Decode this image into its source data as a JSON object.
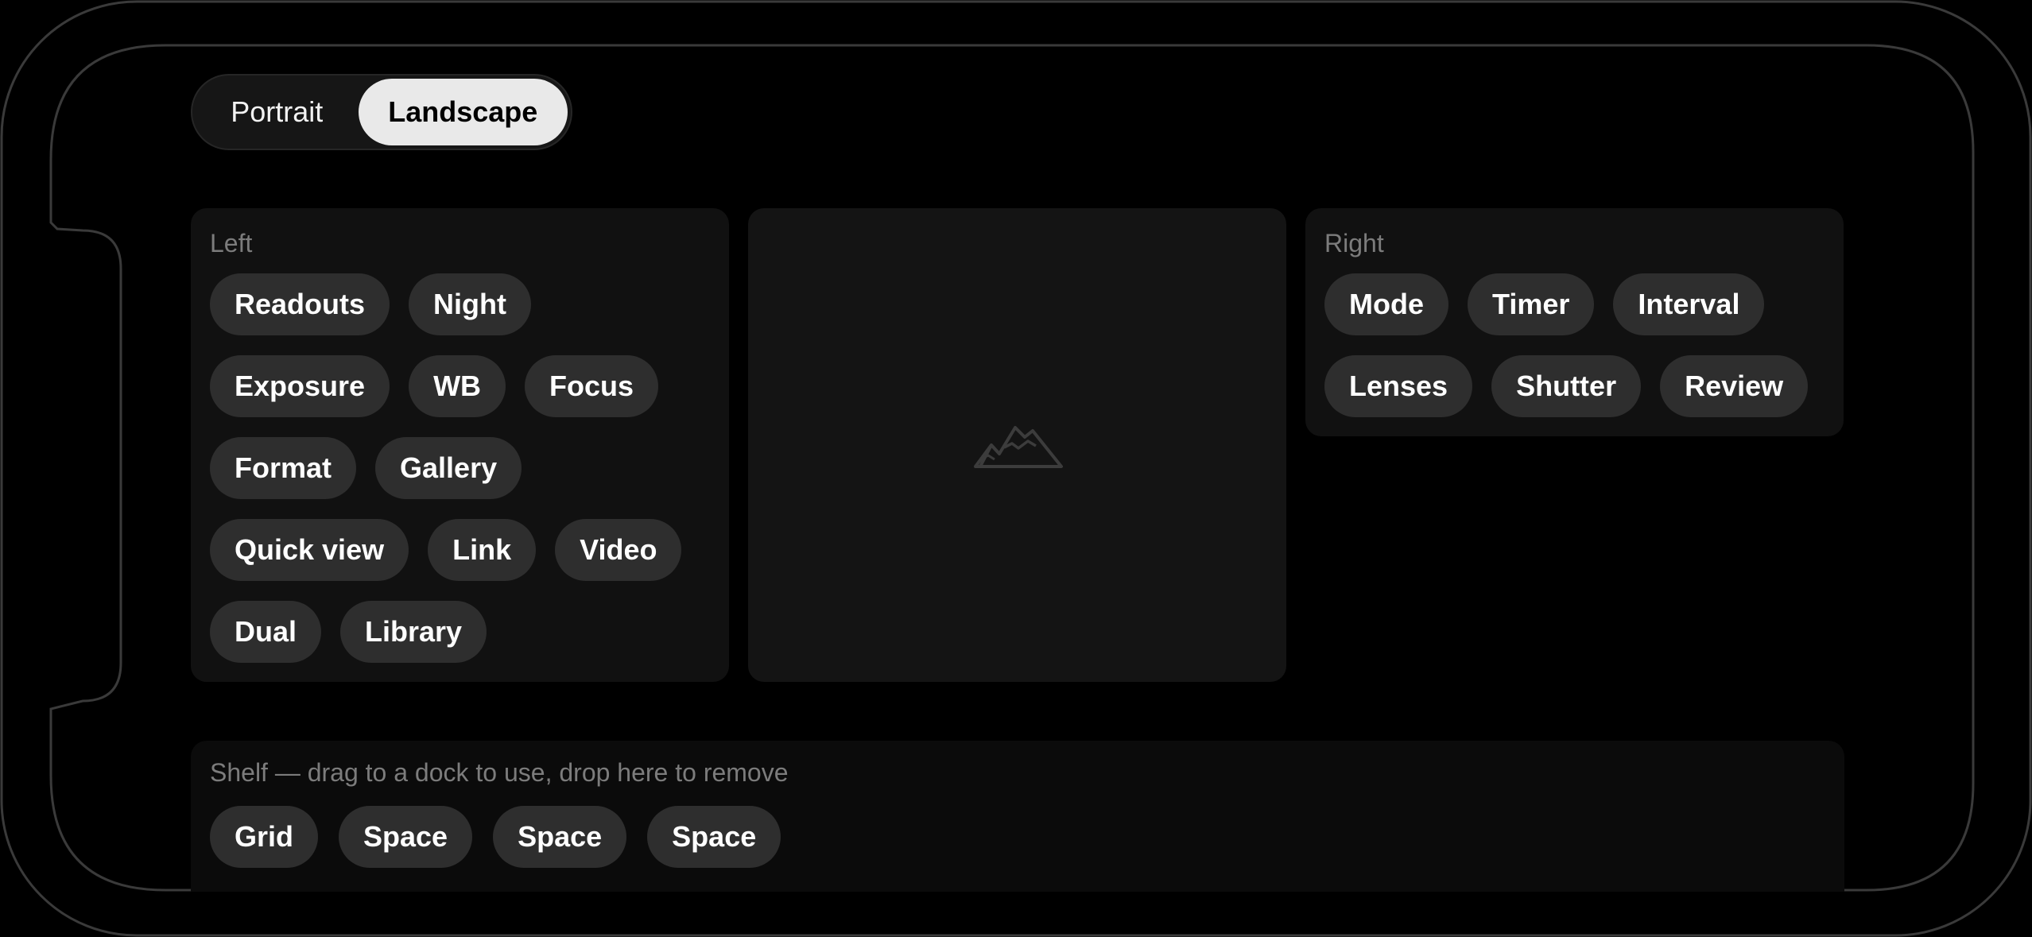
{
  "orientation": {
    "options": [
      "Portrait",
      "Landscape"
    ],
    "selected": "Landscape"
  },
  "left_dock": {
    "label": "Left",
    "rows": [
      [
        "Readouts",
        "Night"
      ],
      [
        "Exposure",
        "WB",
        "Focus"
      ],
      [
        "Format",
        "Gallery"
      ],
      [
        "Quick view",
        "Link",
        "Video"
      ],
      [
        "Dual",
        "Library"
      ]
    ]
  },
  "preview": {
    "icon": "mountains-icon"
  },
  "right_dock": {
    "label": "Right",
    "rows": [
      [
        "Mode",
        "Timer",
        "Interval"
      ],
      [
        "Lenses",
        "Shutter",
        "Review"
      ]
    ]
  },
  "shelf": {
    "label": "Shelf — drag to a dock to use, drop here to remove",
    "items": [
      "Grid",
      "Space",
      "Space",
      "Space"
    ]
  }
}
